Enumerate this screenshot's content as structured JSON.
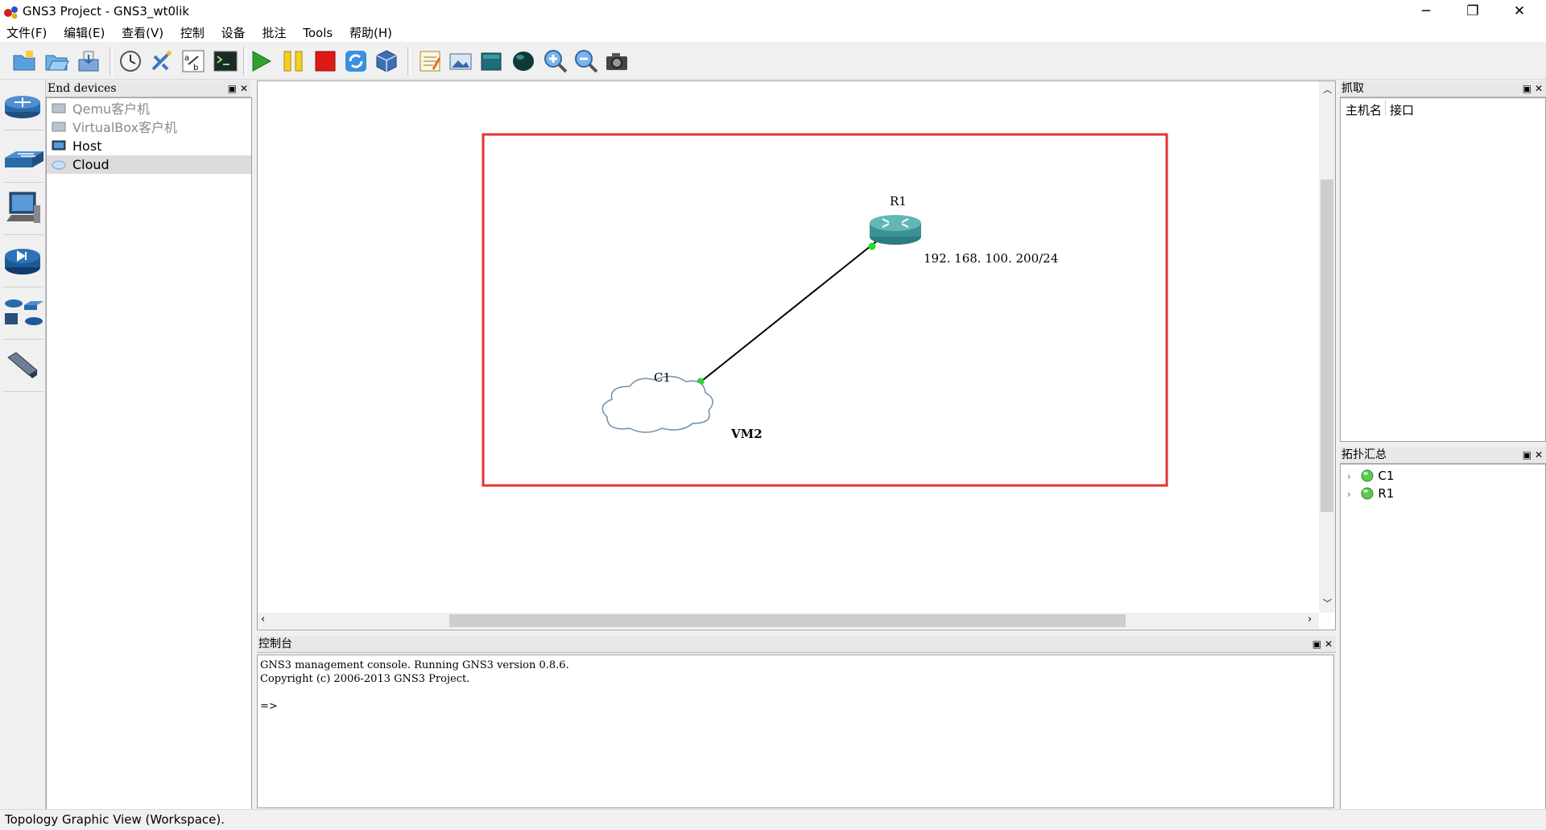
{
  "window": {
    "title": "GNS3 Project - GNS3_wt0lik",
    "controls": {
      "minimize": "─",
      "restore": "❐",
      "close": "✕"
    }
  },
  "menu": [
    "文件(F)",
    "编辑(E)",
    "查看(V)",
    "控制",
    "设备",
    "批注",
    "Tools",
    "帮助(H)"
  ],
  "toolbar": {
    "icons": [
      "new-project-icon",
      "open-project-icon",
      "save-project-icon",
      "snapshot-icon",
      "auto-layout-icon",
      "show-interface-labels-icon",
      "console-all-icon",
      "start-all-icon",
      "suspend-all-icon",
      "stop-all-icon",
      "reload-all-icon",
      "virtualbox-icon",
      "add-note-icon",
      "insert-picture-icon",
      "draw-rectangle-icon",
      "draw-ellipse-icon",
      "zoom-in-icon",
      "zoom-out-icon",
      "screenshot-icon"
    ]
  },
  "device_strip": [
    "routers-icon",
    "switches-icon",
    "end-devices-icon",
    "security-devices-icon",
    "all-devices-icon",
    "add-link-icon"
  ],
  "end_devices": {
    "title": "End devices",
    "items": [
      {
        "label": "Qemu客户机",
        "enabled": false
      },
      {
        "label": "VirtualBox客户机",
        "enabled": false
      },
      {
        "label": "Host",
        "enabled": true
      },
      {
        "label": "Cloud",
        "enabled": true,
        "selected": true
      }
    ]
  },
  "topology": {
    "router": {
      "name": "R1",
      "ip_label": "192. 168. 100. 200/24"
    },
    "cloud": {
      "name": "C1",
      "note": "VM2"
    },
    "colors": {
      "frame": "#e53333",
      "link": "#000000",
      "port_up": "#22dd22"
    }
  },
  "capture": {
    "title": "抓取",
    "col_host": "主机名",
    "col_iface": "接口"
  },
  "summary": {
    "title": "拓扑汇总",
    "items": [
      "C1",
      "R1"
    ]
  },
  "console": {
    "title": "控制台",
    "text": "GNS3 management console. Running GNS3 version 0.8.6.\nCopyright (c) 2006-2013 GNS3 Project.\n\n=>"
  },
  "status": "Topology Graphic View (Workspace)."
}
